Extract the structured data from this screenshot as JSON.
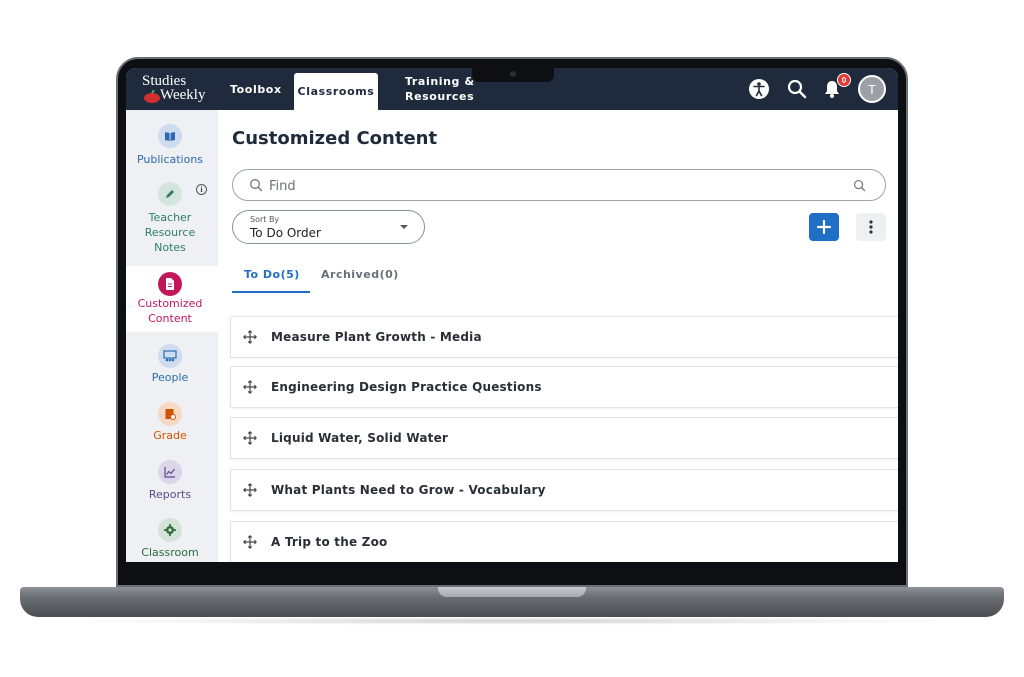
{
  "header": {
    "logo_line1": "Studies",
    "logo_line2": "Weekly",
    "nav": {
      "toolbox": "Toolbox",
      "classrooms": "Classrooms",
      "training": "Training & Resources"
    },
    "notification_count": "0",
    "avatar_initial": "T",
    "colors": {
      "bar": "#1f2a3c",
      "badge": "#e53935"
    }
  },
  "sidebar": {
    "items": [
      {
        "label": "Publications",
        "icon": "book-icon",
        "color": "#2b6cb0"
      },
      {
        "label": "Teacher Resource Notes",
        "icon": "pen-icon",
        "color": "#2e7d6b"
      },
      {
        "label": "Customized Content",
        "icon": "document-icon",
        "color": "#c2185b"
      },
      {
        "label": "People",
        "icon": "people-icon",
        "color": "#2b6cb0"
      },
      {
        "label": "Grade",
        "icon": "grade-icon",
        "color": "#d35400"
      },
      {
        "label": "Reports",
        "icon": "chart-icon",
        "color": "#5b4a8a"
      },
      {
        "label": "Classroom",
        "icon": "gear-icon",
        "color": "#2e6b3a"
      }
    ]
  },
  "main": {
    "title": "Customized Content",
    "search_placeholder": "Find",
    "sort": {
      "caption": "Sort By",
      "value": "To Do Order"
    },
    "tabs": [
      {
        "label": "To Do(5)",
        "active": true
      },
      {
        "label": "Archived(0)",
        "active": false
      }
    ],
    "items": [
      "Measure Plant Growth - Media",
      "Engineering Design Practice Questions",
      "Liquid Water, Solid Water",
      "What Plants Need to Grow - Vocabulary",
      "A Trip to the Zoo"
    ],
    "accent": "#1f6fc5"
  }
}
